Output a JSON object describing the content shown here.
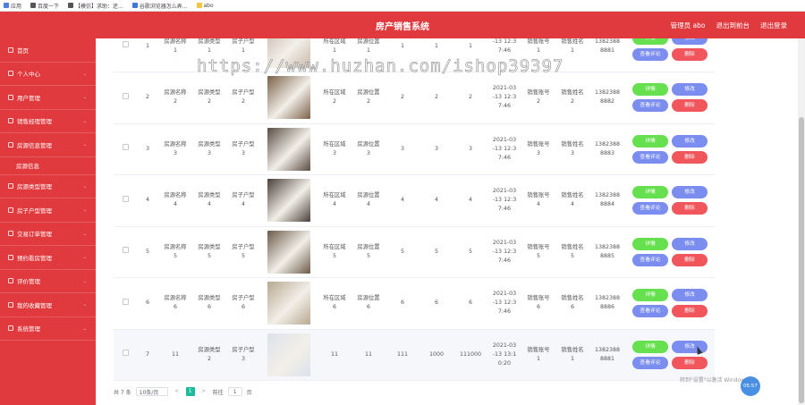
{
  "bookmarks": [
    {
      "label": "应用",
      "color": "#4a7fdc"
    },
    {
      "label": "百度一下",
      "color": "#555555"
    },
    {
      "label": "【模仿】求助：还...",
      "color": "#555555"
    },
    {
      "label": "谷歌浏览器怎么弄...",
      "color": "#3b7ad8"
    },
    {
      "label": "abo",
      "color": "#f5c542"
    }
  ],
  "header": {
    "title": "房产销售系统",
    "user": "管理员 abo",
    "back_link": "退出到前台",
    "logout_link": "退出登录"
  },
  "sidebar": {
    "items": [
      {
        "label": "首页"
      },
      {
        "label": "个人中心"
      },
      {
        "label": "用户管理"
      },
      {
        "label": "销售经理管理"
      },
      {
        "label": "房源信息管理"
      }
    ],
    "submenu": "房源信息",
    "items2": [
      {
        "label": "房源类型管理"
      },
      {
        "label": "房子户型管理"
      },
      {
        "label": "交易订单管理"
      },
      {
        "label": "预约看房管理"
      },
      {
        "label": "评价管理"
      },
      {
        "label": "我的收藏管理"
      },
      {
        "label": "系统管理"
      }
    ]
  },
  "watermark": "https://www.huzhan.com/ishop39397",
  "actions": {
    "detail": "详情",
    "edit": "修改",
    "review": "查看评论",
    "delete": "删除"
  },
  "rows": [
    {
      "idx": "1",
      "name": "房源名称\n1",
      "type": "房源类型\n1",
      "layout": "房子户型\n1",
      "img_color": "#c9b8a8",
      "area": "所在区域\n1",
      "location": "房源位置\n1",
      "c1": "1",
      "c2": "1",
      "c3": "1",
      "time": "-13 12:3\n7:46",
      "account": "销售账号\n1",
      "seller": "销售姓名\n1",
      "phone": "1382388\n8881"
    },
    {
      "idx": "2",
      "name": "房源名称\n2",
      "type": "房源类型\n2",
      "layout": "房子户型\n2",
      "img_color": "#7a6048",
      "area": "所在区域\n2",
      "location": "房源位置\n2",
      "c1": "2",
      "c2": "2",
      "c3": "2",
      "time": "2021-03\n-13 12:3\n7:46",
      "account": "销售账号\n2",
      "seller": "销售姓名\n2",
      "phone": "1382388\n8882"
    },
    {
      "idx": "3",
      "name": "房源名称\n3",
      "type": "房源类型\n3",
      "layout": "房子户型\n3",
      "img_color": "#5a4b40",
      "area": "所在区域\n3",
      "location": "房源位置\n3",
      "c1": "3",
      "c2": "3",
      "c3": "3",
      "time": "2021-03\n-13 12:3\n7:46",
      "account": "销售账号\n3",
      "seller": "销售姓名\n3",
      "phone": "1382388\n8883"
    },
    {
      "idx": "4",
      "name": "房源名称\n4",
      "type": "房源类型\n4",
      "layout": "房子户型\n4",
      "img_color": "#4a3e38",
      "area": "所在区域\n4",
      "location": "房源位置\n4",
      "c1": "4",
      "c2": "4",
      "c3": "4",
      "time": "2021-03\n-13 12:3\n7:46",
      "account": "销售账号\n4",
      "seller": "销售姓名\n4",
      "phone": "1382388\n8884"
    },
    {
      "idx": "5",
      "name": "房源名称\n5",
      "type": "房源类型\n5",
      "layout": "房子户型\n5",
      "img_color": "#6b5a48",
      "area": "所在区域\n5",
      "location": "房源位置\n5",
      "c1": "5",
      "c2": "5",
      "c3": "5",
      "time": "2021-03\n-13 12:3\n7:46",
      "account": "销售账号\n5",
      "seller": "销售姓名\n5",
      "phone": "1382388\n8885"
    },
    {
      "idx": "6",
      "name": "房源名称\n6",
      "type": "房源类型\n6",
      "layout": "房子户型\n6",
      "img_color": "#b8a890",
      "area": "所在区域\n6",
      "location": "房源位置\n6",
      "c1": "6",
      "c2": "6",
      "c3": "6",
      "time": "2021-03\n-13 12:3\n7:46",
      "account": "销售账号\n6",
      "seller": "销售姓名\n6",
      "phone": "1382388\n8886"
    },
    {
      "idx": "7",
      "name": "11",
      "type": "房源类型\n2",
      "layout": "房子户型\n3",
      "img_color": "#dde2ea",
      "area": "11",
      "location": "11",
      "c1": "111",
      "c2": "1000",
      "c3": "111000",
      "time": "2021-03\n-13 13:1\n0:20",
      "account": "销售账号\n1",
      "seller": "销售姓名\n1",
      "phone": "1382388\n8881"
    }
  ],
  "pagination": {
    "total": "共 7 条",
    "page_size": "10条/页",
    "prev": "<",
    "current": "1",
    "next": ">",
    "goto_label": "前往",
    "goto_value": "1",
    "page_unit": "页"
  },
  "overlay_note": "转到\"设置\"以激活 Windows。",
  "timer": "05:57",
  "colors": {
    "brand": "#e03a3e",
    "green": "#67e04f",
    "blue": "#7b8ef0",
    "red": "#f0565b",
    "page_active": "#1abc9c"
  }
}
